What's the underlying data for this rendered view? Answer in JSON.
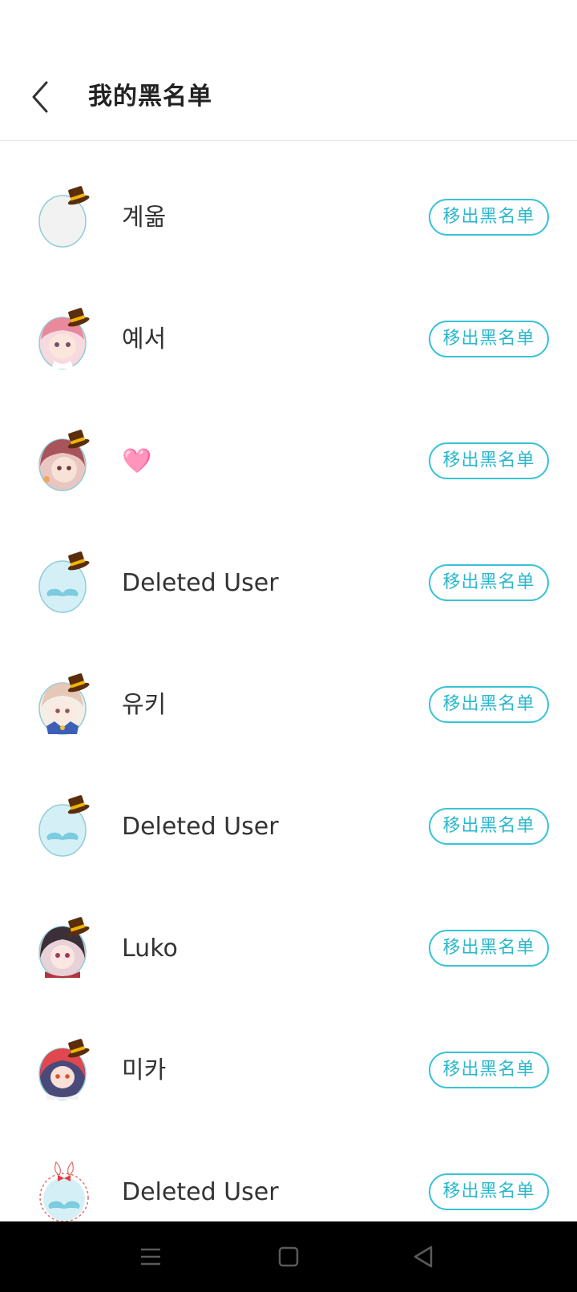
{
  "header": {
    "title": "我的黑名单",
    "back_icon": "chevron-left-icon"
  },
  "blacklist": [
    {
      "name": "계옮",
      "avatar": "egg-plain",
      "action": "移出黑名单"
    },
    {
      "name": "예서",
      "avatar": "anime-pink-hair",
      "action": "移出黑名单"
    },
    {
      "name": "🩷",
      "avatar": "anime-auburn-hair",
      "action": "移出黑名单"
    },
    {
      "name": "Deleted User",
      "avatar": "egg-mustache",
      "action": "移出黑名单"
    },
    {
      "name": "유키",
      "avatar": "anime-light-hair",
      "action": "移出黑名单"
    },
    {
      "name": "Deleted User",
      "avatar": "egg-mustache",
      "action": "移出黑名单"
    },
    {
      "name": "Luko",
      "avatar": "anime-dark-hair",
      "action": "移出黑名单"
    },
    {
      "name": "미카",
      "avatar": "anime-red-hair",
      "action": "移出黑名单"
    },
    {
      "name": "Deleted User",
      "avatar": "egg-mustache-bunny",
      "action": "移出黑名单"
    }
  ],
  "nav_bar": {
    "menu_icon": "menu-icon",
    "home_icon": "home-icon",
    "back_icon": "back-triangle-icon"
  },
  "colors": {
    "accent": "#29b7cc",
    "button_border": "#39c3d6",
    "hat": "#5a2d0c",
    "hat_band": "#f0b400",
    "nav_bar": "#000000"
  }
}
